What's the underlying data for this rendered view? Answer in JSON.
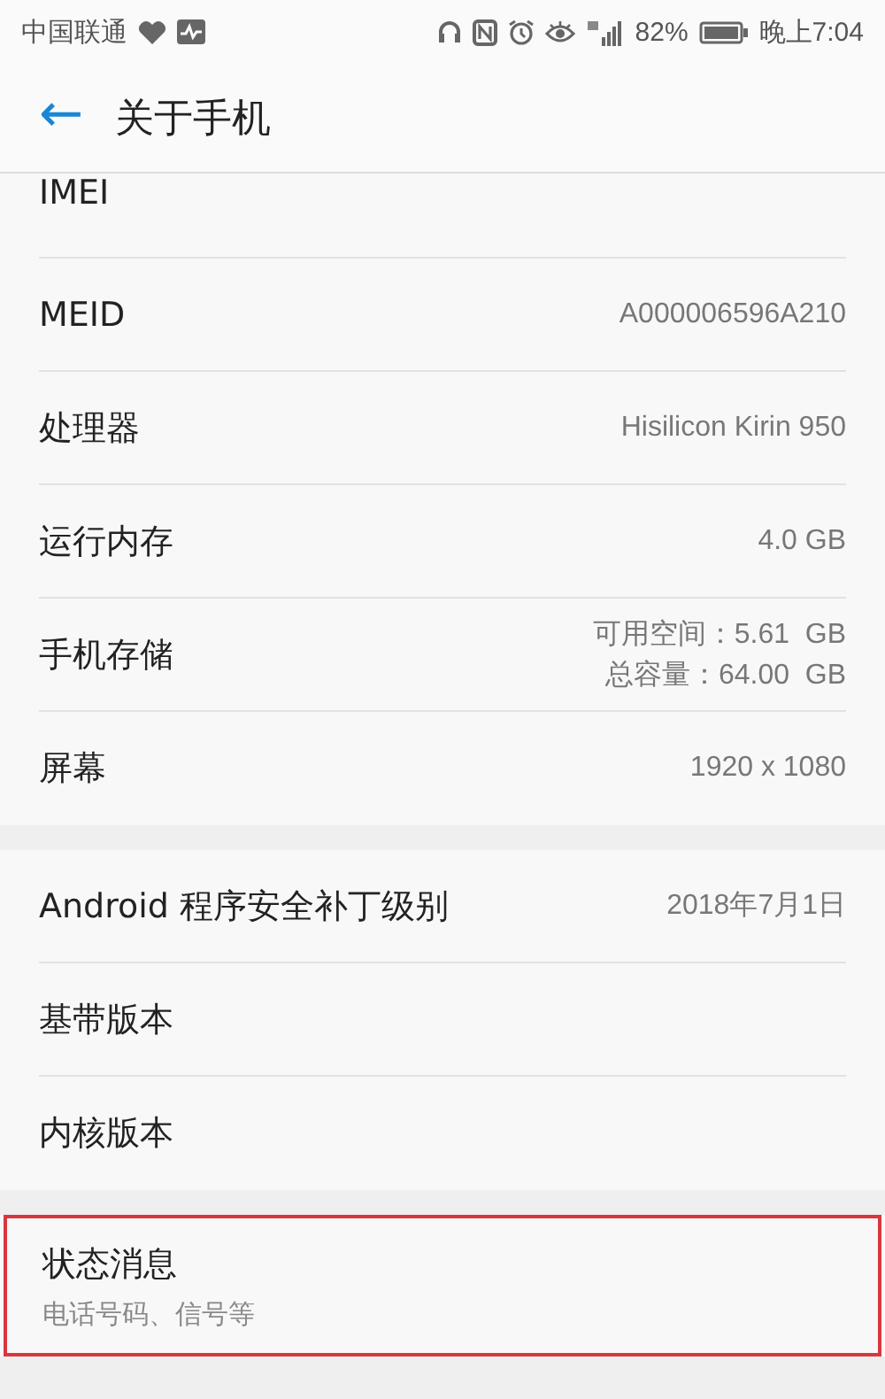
{
  "status_bar": {
    "carrier": "中国联通",
    "battery_percent": "82%",
    "time": "晚上7:04"
  },
  "header": {
    "back": "←",
    "title": "关于手机"
  },
  "groups": [
    {
      "rows": [
        {
          "label": "IMEI",
          "values": [],
          "highlighted": false
        },
        {
          "label": "MEID",
          "values": [
            "A000006596A210"
          ],
          "highlighted": false
        },
        {
          "label": "处理器",
          "values": [
            "Hisilicon Kirin 950"
          ],
          "highlighted": false
        },
        {
          "label": "运行内存",
          "values": [
            "4.0 GB"
          ],
          "highlighted": false
        },
        {
          "label": "手机存储",
          "values": [
            "可用空间：5.61  GB",
            "总容量：64.00  GB"
          ],
          "highlighted": false
        },
        {
          "label": "屏幕",
          "values": [
            "1920 x 1080"
          ],
          "highlighted": false
        }
      ]
    },
    {
      "rows": [
        {
          "label": "Android 程序安全补丁级别",
          "values": [
            "2018年7月1日"
          ],
          "highlighted": false
        },
        {
          "label": "基带版本",
          "values": [],
          "highlighted": false
        },
        {
          "label": "内核版本",
          "values": [],
          "highlighted": false
        }
      ]
    },
    {
      "rows": [
        {
          "label": "状态消息",
          "subtitle": "电话号码、信号等",
          "values": [],
          "highlighted": true
        }
      ]
    }
  ]
}
